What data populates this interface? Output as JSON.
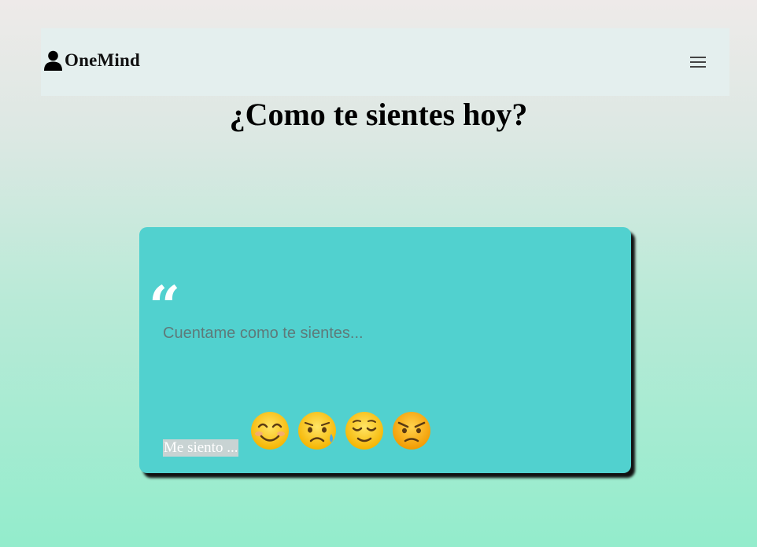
{
  "nav": {
    "brand": "OneMind",
    "icons": {
      "user": "user-icon",
      "menu": "hamburger-menu-icon"
    }
  },
  "heading": "¿Como te sientes hoy?",
  "card": {
    "quote_glyph": "“",
    "input_placeholder": "Cuentame como te sientes...",
    "mood_label": "Me siento ...",
    "emojis": [
      {
        "name": "smiling-face",
        "glyph": "😊"
      },
      {
        "name": "sad-sweat-face",
        "glyph": "😥"
      },
      {
        "name": "relieved-face",
        "glyph": "😌"
      },
      {
        "name": "angry-face",
        "glyph": "😠"
      }
    ]
  },
  "colors": {
    "card": "#51d1cf",
    "navbar": "#e4efee",
    "bg_top": "#eeeae9",
    "bg_bottom": "#93eccc"
  }
}
